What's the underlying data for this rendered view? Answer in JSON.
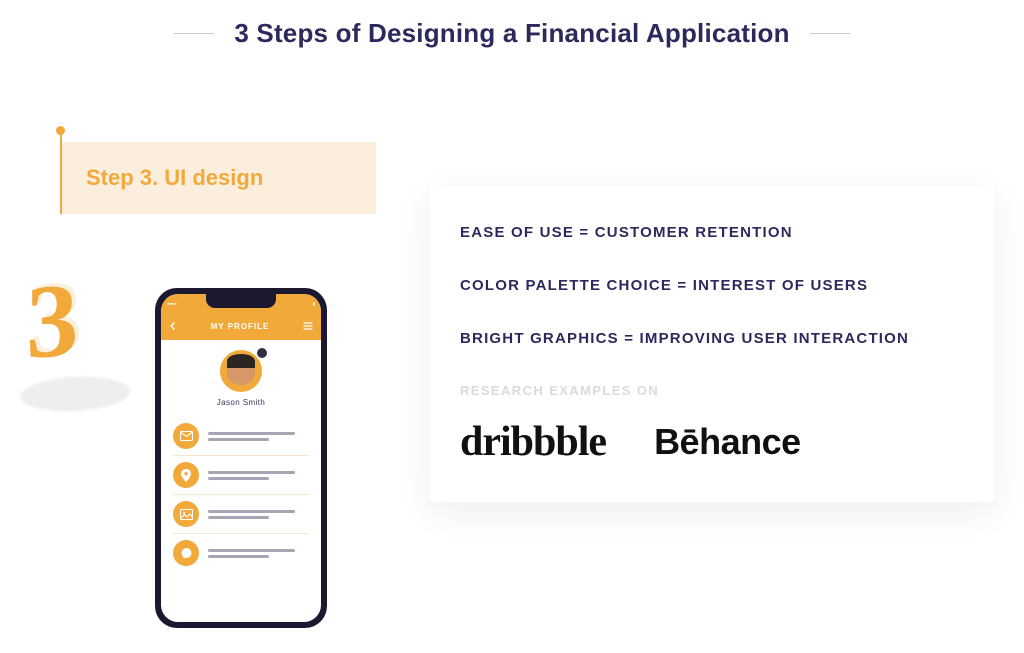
{
  "title": "3 Steps of Designing a Financial Application",
  "step": {
    "number": "3",
    "label": "Step 3. UI design"
  },
  "phone": {
    "header_title": "MY PROFILE",
    "profile_name": "Jason Smith"
  },
  "points": [
    "EASE OF USE = CUSTOMER RETENTION",
    "COLOR PALETTE CHOICE = INTEREST OF USERS",
    "BRIGHT GRAPHICS = IMPROVING USER INTERACTION"
  ],
  "research_label": "RESEARCH EXAMPLES ON",
  "brands": {
    "dribbble": "dribbble",
    "behance": "Bēhance"
  },
  "colors": {
    "accent_orange": "#f1a93a",
    "badge_bg": "#fbeedc",
    "text_navy": "#2c2a5c"
  }
}
